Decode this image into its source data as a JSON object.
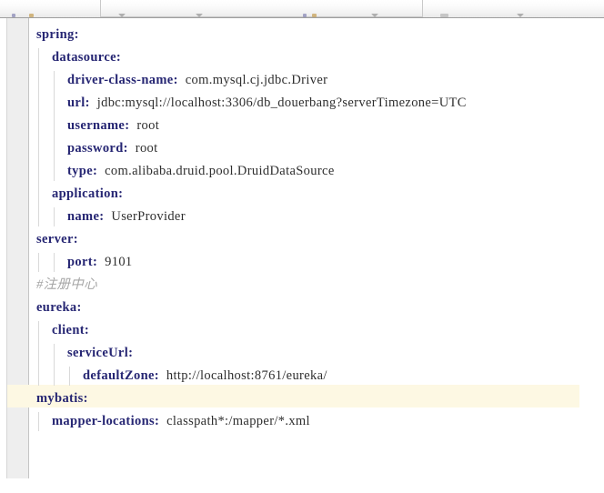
{
  "window": {
    "type": "code-editor",
    "file_language": "YAML"
  },
  "toolbar": {
    "visible_sliver": true,
    "icon_names": [
      "square-icon",
      "bookmark-icon",
      "chevron-down-icon",
      "chevron-down-icon",
      "square-icon",
      "square-icon",
      "chevron-down-icon",
      "dash-icon",
      "chevron-down-icon"
    ]
  },
  "editor": {
    "gutter_visible": true,
    "gutter_line_numbers": [],
    "current_line_index": 16,
    "colors": {
      "key": "#262673",
      "value": "#2e2e2e",
      "comment": "#a6a6a6",
      "current_line_bg": "#fdf8e3",
      "gutter_bg": "#eeeeee",
      "background": "#ffffff"
    },
    "lines": [
      {
        "indent": 0,
        "key": "spring",
        "sep": ":",
        "value": ""
      },
      {
        "indent": 1,
        "key": "datasource",
        "sep": ":",
        "value": ""
      },
      {
        "indent": 2,
        "key": "driver-class-name",
        "sep": ":",
        "value": "com.mysql.cj.jdbc.Driver"
      },
      {
        "indent": 2,
        "key": "url",
        "sep": ":",
        "value": "jdbc:mysql://localhost:3306/db_douerbang?serverTimezone=UTC"
      },
      {
        "indent": 2,
        "key": "username",
        "sep": ":",
        "value": "root"
      },
      {
        "indent": 2,
        "key": "password",
        "sep": ":",
        "value": "root"
      },
      {
        "indent": 2,
        "key": "type",
        "sep": ":",
        "value": "com.alibaba.druid.pool.DruidDataSource"
      },
      {
        "indent": 1,
        "key": "application",
        "sep": ":",
        "value": ""
      },
      {
        "indent": 2,
        "key": "name",
        "sep": ":",
        "value": "UserProvider"
      },
      {
        "indent": 0,
        "key": "server",
        "sep": ":",
        "value": ""
      },
      {
        "indent": 2,
        "key": "port",
        "sep": ":",
        "value": "9101"
      },
      {
        "indent": 0,
        "comment": "#注册中心"
      },
      {
        "indent": 0,
        "key": "eureka",
        "sep": ":",
        "value": ""
      },
      {
        "indent": 1,
        "key": "client",
        "sep": ":",
        "value": ""
      },
      {
        "indent": 2,
        "key": "serviceUrl",
        "sep": ":",
        "value": ""
      },
      {
        "indent": 3,
        "key": "defaultZone",
        "sep": ":",
        "value": "http://localhost:8761/eureka/"
      },
      {
        "indent": 0,
        "key": "mybatis",
        "sep": ":",
        "value": ""
      },
      {
        "indent": 1,
        "key": "mapper-locations",
        "sep": ":",
        "value": "classpath*:/mapper/*.xml"
      }
    ]
  }
}
